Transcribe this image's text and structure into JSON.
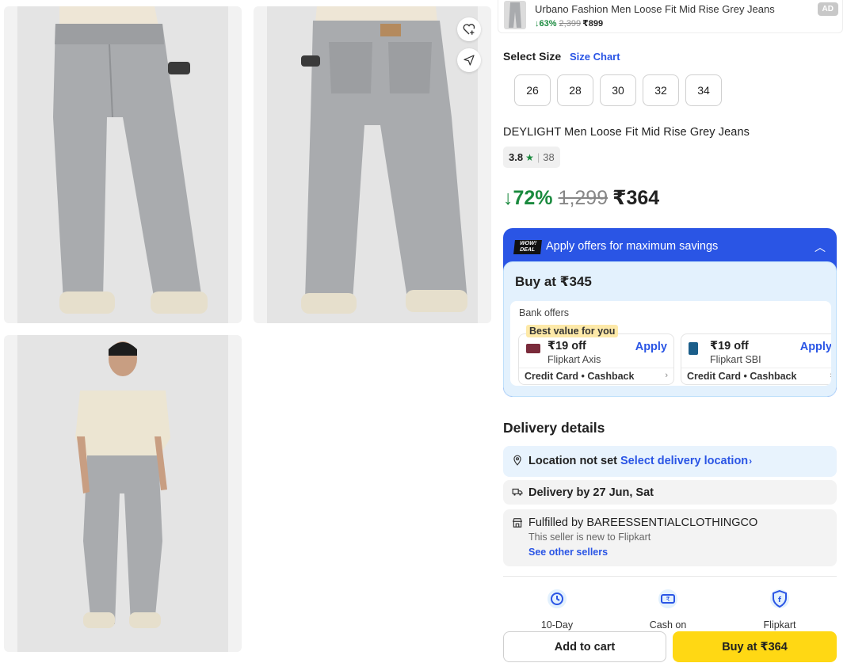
{
  "gallery": {
    "images": [
      "jeans-front-view",
      "jeans-back-view",
      "jeans-full-body-model"
    ]
  },
  "actions": {
    "wishlist_icon": "heart-plus-icon",
    "share_icon": "share-icon"
  },
  "ad": {
    "title": "Urbano Fashion Men Loose Fit Mid Rise Grey Jeans",
    "discount": "63%",
    "mrp": "2,399",
    "price": "₹899",
    "badge": "AD"
  },
  "sizes": {
    "label": "Select Size",
    "chart_link": "Size Chart",
    "options": [
      "26",
      "28",
      "30",
      "32",
      "34"
    ]
  },
  "product": {
    "title": "DEYLIGHT Men Loose Fit Mid Rise Grey Jeans",
    "rating": "3.8",
    "rating_count": "38",
    "discount": "72%",
    "mrp": "1,299",
    "price": "₹364"
  },
  "offers": {
    "badge_line1": "WOW!",
    "badge_line2": "DEAL",
    "title": "Apply offers for maximum savings",
    "buy_at": "Buy at ₹345",
    "bank_label": "Bank offers",
    "best_value": "Best value for you",
    "items": [
      {
        "amount": "₹19 off",
        "bank": "Flipkart Axis",
        "apply": "Apply",
        "type": "Credit Card • Cashback",
        "card_color": "#7a2b3b"
      },
      {
        "amount": "₹19 off",
        "bank": "Flipkart SBI",
        "apply": "Apply",
        "type": "Credit Card • Cashback",
        "card_color": "#1b5e8a"
      }
    ]
  },
  "delivery": {
    "heading": "Delivery details",
    "location_text": "Location not set",
    "location_link": "Select delivery location",
    "date_text": "Delivery by 27 Jun, Sat",
    "seller_text": "Fulfilled by BAREESSENTIALCLOTHINGCO",
    "seller_sub": "This seller is new to Flipkart",
    "seller_link": "See other sellers"
  },
  "features": [
    {
      "label": "10-Day",
      "icon": "return-icon"
    },
    {
      "label": "Cash on",
      "icon": "cash-icon"
    },
    {
      "label": "Flipkart",
      "icon": "flipkart-assured-icon"
    }
  ],
  "buttons": {
    "add_to_cart": "Add to cart",
    "buy_now": "Buy at ₹364"
  },
  "colors": {
    "accent_blue": "#2a55e5",
    "discount_green": "#1a8a3e",
    "buy_yellow": "#ffd814"
  }
}
